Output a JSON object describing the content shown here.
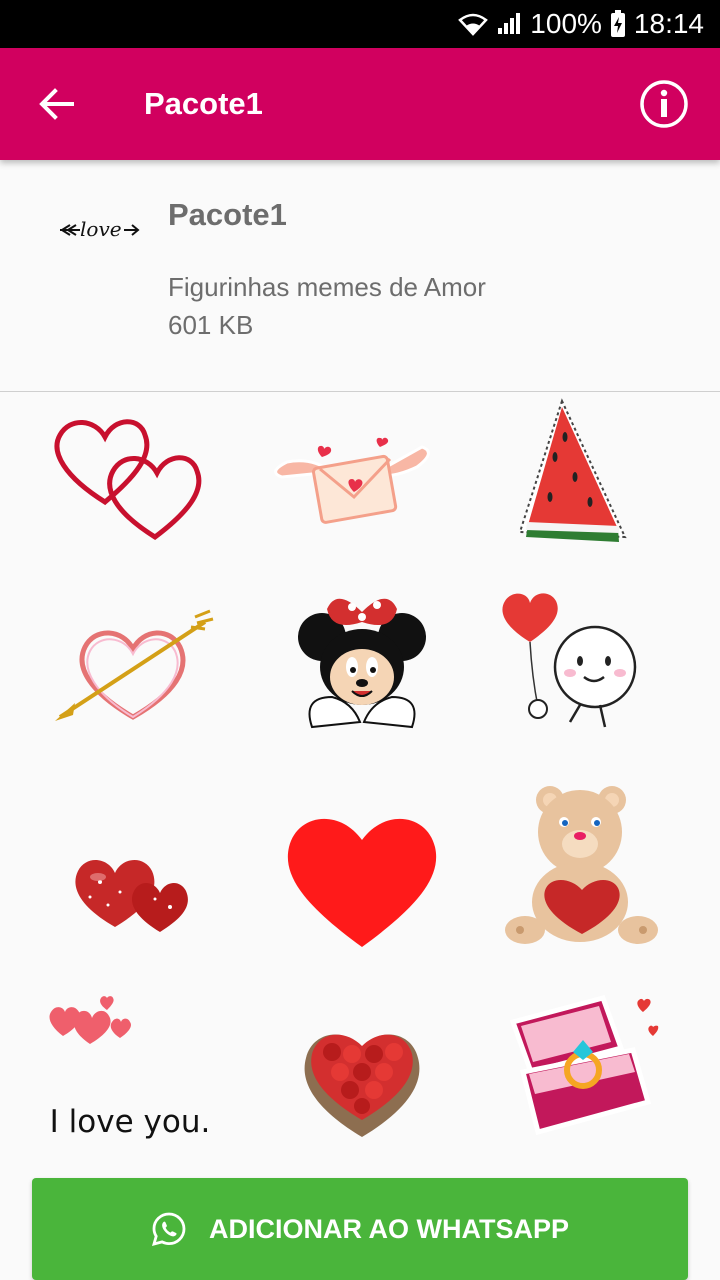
{
  "status_bar": {
    "battery": "100%",
    "time": "18:14",
    "icons": [
      "wifi-icon",
      "signal-icon",
      "battery-charging-icon"
    ]
  },
  "app_bar": {
    "title": "Pacote1",
    "back_icon": "arrow-left-icon",
    "info_icon": "info-icon",
    "color": "#d1005f"
  },
  "pack": {
    "name": "Pacote1",
    "description": "Figurinhas memes de Amor",
    "size": "601 KB",
    "tray_text": "love"
  },
  "stickers": [
    {
      "name": "double-heart-outline"
    },
    {
      "name": "winged-love-letter"
    },
    {
      "name": "watermelon-slice"
    },
    {
      "name": "heart-with-arrow"
    },
    {
      "name": "minnie-mouse-heart-hands"
    },
    {
      "name": "smiley-with-heart-balloon"
    },
    {
      "name": "glitter-hearts"
    },
    {
      "name": "big-red-heart"
    },
    {
      "name": "teddy-bear-with-heart"
    },
    {
      "name": "i-love-you-text",
      "text": "I love you."
    },
    {
      "name": "rose-heart"
    },
    {
      "name": "ring-box"
    }
  ],
  "add_button": {
    "label": "ADICIONAR AO WHATSAPP",
    "icon": "whatsapp-icon",
    "color": "#4ab53b"
  }
}
